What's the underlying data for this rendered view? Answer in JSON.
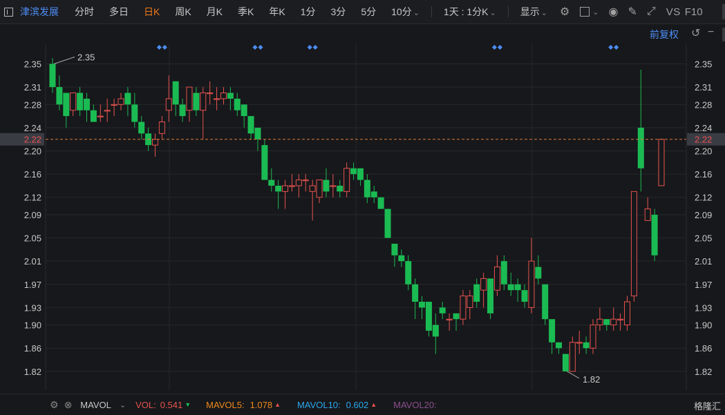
{
  "toolbar": {
    "stock_name": "津滨发展",
    "tabs": [
      "分时",
      "多日",
      "日K",
      "周K",
      "月K",
      "季K",
      "年K",
      "1分",
      "3分",
      "5分",
      "10分"
    ],
    "interval_select": "1天 : 1分K",
    "display_label": "显示",
    "vs_label": "VS",
    "f10_label": "F10"
  },
  "chart_header": {
    "adjust_label": "前复权"
  },
  "colors": {
    "up": "#e8534f",
    "down": "#1bbb53",
    "background": "#17181b",
    "last_price_line": "#e07b39",
    "markers": "#4d8ef7"
  },
  "chart_data": {
    "type": "candlestick",
    "ylim": [
      1.8,
      2.37
    ],
    "y_ticks": [
      2.35,
      2.31,
      2.28,
      2.24,
      2.2,
      2.16,
      2.12,
      2.09,
      2.05,
      2.01,
      1.97,
      1.93,
      1.9,
      1.86,
      1.82
    ],
    "last_price": 2.22,
    "max_label": 2.35,
    "min_label": 1.82,
    "candles": [
      [
        2.35,
        2.31,
        2.36,
        2.3
      ],
      [
        2.31,
        2.28,
        2.33,
        2.27
      ],
      [
        2.3,
        2.26,
        2.3,
        2.24
      ],
      [
        2.27,
        2.3,
        2.3,
        2.26
      ],
      [
        2.3,
        2.27,
        2.31,
        2.26
      ],
      [
        2.29,
        2.27,
        2.3,
        2.25
      ],
      [
        2.27,
        2.25,
        2.28,
        2.25
      ],
      [
        2.26,
        2.26,
        2.28,
        2.25
      ],
      [
        2.27,
        2.27,
        2.29,
        2.25
      ],
      [
        2.28,
        2.28,
        2.29,
        2.26
      ],
      [
        2.28,
        2.29,
        2.3,
        2.27
      ],
      [
        2.3,
        2.28,
        2.31,
        2.26
      ],
      [
        2.28,
        2.25,
        2.3,
        2.24
      ],
      [
        2.25,
        2.23,
        2.26,
        2.22
      ],
      [
        2.23,
        2.21,
        2.24,
        2.2
      ],
      [
        2.21,
        2.22,
        2.23,
        2.19
      ],
      [
        2.23,
        2.25,
        2.26,
        2.22
      ],
      [
        2.27,
        2.29,
        2.33,
        2.25
      ],
      [
        2.32,
        2.28,
        2.32,
        2.26
      ],
      [
        2.28,
        2.26,
        2.29,
        2.25
      ],
      [
        2.27,
        2.31,
        2.31,
        2.25
      ],
      [
        2.3,
        2.27,
        2.31,
        2.26
      ],
      [
        2.27,
        2.3,
        2.31,
        2.22
      ],
      [
        2.3,
        2.3,
        2.32,
        2.28
      ],
      [
        2.29,
        2.29,
        2.31,
        2.27
      ],
      [
        2.29,
        2.3,
        2.31,
        2.28
      ],
      [
        2.3,
        2.29,
        2.31,
        2.27
      ],
      [
        2.29,
        2.27,
        2.3,
        2.26
      ],
      [
        2.28,
        2.26,
        2.28,
        2.24
      ],
      [
        2.26,
        2.23,
        2.26,
        2.22
      ],
      [
        2.24,
        2.22,
        2.24,
        2.2
      ],
      [
        2.21,
        2.15,
        2.22,
        2.15
      ],
      [
        2.15,
        2.14,
        2.17,
        2.13
      ],
      [
        2.14,
        2.13,
        2.15,
        2.1
      ],
      [
        2.13,
        2.14,
        2.15,
        2.1
      ],
      [
        2.14,
        2.14,
        2.16,
        2.13
      ],
      [
        2.14,
        2.15,
        2.16,
        2.12
      ],
      [
        2.15,
        2.15,
        2.16,
        2.13
      ],
      [
        2.13,
        2.14,
        2.15,
        2.08
      ],
      [
        2.12,
        2.15,
        2.15,
        2.11
      ],
      [
        2.15,
        2.13,
        2.17,
        2.12
      ],
      [
        2.14,
        2.14,
        2.16,
        2.12
      ],
      [
        2.14,
        2.13,
        2.15,
        2.12
      ],
      [
        2.13,
        2.17,
        2.18,
        2.12
      ],
      [
        2.17,
        2.16,
        2.18,
        2.15
      ],
      [
        2.17,
        2.15,
        2.17,
        2.14
      ],
      [
        2.15,
        2.12,
        2.16,
        2.11
      ],
      [
        2.13,
        2.12,
        2.14,
        2.11
      ],
      [
        2.12,
        2.1,
        2.12,
        2.1
      ],
      [
        2.1,
        2.05,
        2.1,
        2.05
      ],
      [
        2.04,
        2.02,
        2.04,
        2.0
      ],
      [
        2.02,
        2.01,
        2.03,
        2.0
      ],
      [
        2.01,
        1.97,
        2.02,
        1.96
      ],
      [
        1.97,
        1.94,
        1.98,
        1.91
      ],
      [
        1.94,
        1.93,
        1.95,
        1.91
      ],
      [
        1.94,
        1.89,
        1.94,
        1.88
      ],
      [
        1.9,
        1.88,
        1.92,
        1.85
      ],
      [
        1.93,
        1.92,
        1.94,
        1.91
      ],
      [
        1.91,
        1.91,
        1.92,
        1.89
      ],
      [
        1.92,
        1.91,
        1.92,
        1.89
      ],
      [
        1.91,
        1.95,
        1.96,
        1.9
      ],
      [
        1.93,
        1.95,
        1.96,
        1.91
      ],
      [
        1.97,
        1.94,
        1.98,
        1.93
      ],
      [
        1.96,
        1.98,
        1.99,
        1.93
      ],
      [
        1.98,
        1.92,
        1.98,
        1.91
      ],
      [
        1.96,
        2.0,
        2.02,
        1.95
      ],
      [
        2.01,
        1.97,
        2.02,
        1.96
      ],
      [
        1.97,
        1.96,
        1.99,
        1.95
      ],
      [
        1.97,
        1.96,
        1.98,
        1.94
      ],
      [
        1.96,
        1.94,
        1.97,
        1.93
      ],
      [
        1.93,
        2.01,
        2.05,
        1.92
      ],
      [
        2.0,
        1.98,
        2.02,
        1.97
      ],
      [
        1.97,
        1.91,
        1.97,
        1.9
      ],
      [
        1.91,
        1.87,
        1.91,
        1.85
      ],
      [
        1.87,
        1.86,
        1.87,
        1.85
      ],
      [
        1.85,
        1.82,
        1.85,
        1.82
      ],
      [
        1.82,
        1.87,
        1.88,
        1.82
      ],
      [
        1.87,
        1.87,
        1.89,
        1.85
      ],
      [
        1.87,
        1.86,
        1.88,
        1.85
      ],
      [
        1.86,
        1.9,
        1.91,
        1.85
      ],
      [
        1.9,
        1.91,
        1.93,
        1.89
      ],
      [
        1.91,
        1.9,
        1.91,
        1.89
      ],
      [
        1.9,
        1.91,
        1.93,
        1.89
      ],
      [
        1.91,
        1.91,
        1.92,
        1.89
      ],
      [
        1.9,
        1.94,
        1.95,
        1.89
      ],
      [
        1.95,
        2.13,
        2.13,
        1.94
      ],
      [
        2.24,
        2.17,
        2.34,
        2.13
      ],
      [
        2.08,
        2.1,
        2.12,
        2.08
      ],
      [
        2.09,
        2.02,
        2.1,
        2.01
      ],
      [
        2.14,
        2.22,
        2.22,
        2.14
      ]
    ],
    "marker_groups": [
      [
        16
      ],
      [
        30
      ],
      [
        38
      ],
      [
        65
      ],
      [
        82
      ]
    ]
  },
  "indicator_bar": {
    "name": "MAVOL",
    "vol_label": "VOL:",
    "vol_value": "0.541",
    "mavol5_label": "MAVOL5:",
    "mavol5_value": "1.078",
    "mavol10_label": "MAVOL10:",
    "mavol10_value": "0.602",
    "mavol20_label": "MAVOL20:",
    "watermark": "格隆汇"
  }
}
